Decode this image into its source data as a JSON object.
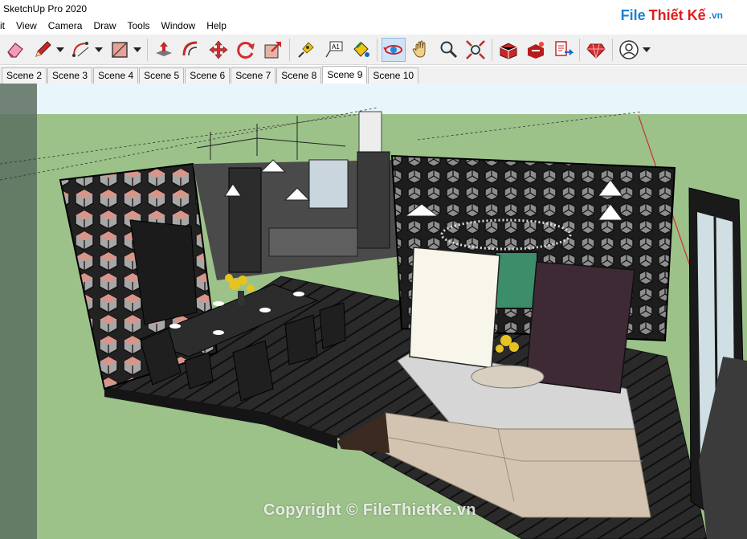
{
  "window": {
    "title": "SketchUp Pro 2020"
  },
  "brand": {
    "part1": "File",
    "part2": "Thiết Kế",
    "part3": ".vn"
  },
  "menu": {
    "items": [
      "it",
      "View",
      "Camera",
      "Draw",
      "Tools",
      "Window",
      "Help"
    ]
  },
  "toolbar": {
    "buttons": [
      {
        "name": "eraser-icon"
      },
      {
        "name": "pencil-icon"
      },
      {
        "name": "arc-icon"
      },
      {
        "name": "rectangle-icon"
      },
      {
        "name": "push-pull-icon"
      },
      {
        "name": "offset-icon"
      },
      {
        "name": "move-icon"
      },
      {
        "name": "rotate-icon"
      },
      {
        "name": "scale-icon"
      },
      {
        "name": "tape-measure-icon"
      },
      {
        "name": "text-icon"
      },
      {
        "name": "paint-bucket-icon"
      },
      {
        "name": "orbit-icon"
      },
      {
        "name": "pan-icon"
      },
      {
        "name": "zoom-icon"
      },
      {
        "name": "zoom-extents-icon"
      },
      {
        "name": "warehouse-icon"
      },
      {
        "name": "extension-warehouse-icon"
      },
      {
        "name": "send-to-layout-icon"
      },
      {
        "name": "ruby-icon"
      },
      {
        "name": "account-icon"
      }
    ],
    "selected": "orbit-icon",
    "text_tool_label": "A1"
  },
  "scenes": {
    "tabs": [
      "Scene 2",
      "Scene 3",
      "Scene 4",
      "Scene 5",
      "Scene 6",
      "Scene 7",
      "Scene 8",
      "Scene 9",
      "Scene 10"
    ],
    "active": "Scene 9"
  },
  "viewport": {
    "sky_color": "#e8f6fb",
    "ground_color": "#9cc28a",
    "watermark": "Copyright © FileThietKe.vn"
  },
  "colors": {
    "accent": "#1e7fd0",
    "brand_red": "#e21c1c",
    "toolbar_bg": "#f0f0f0"
  }
}
